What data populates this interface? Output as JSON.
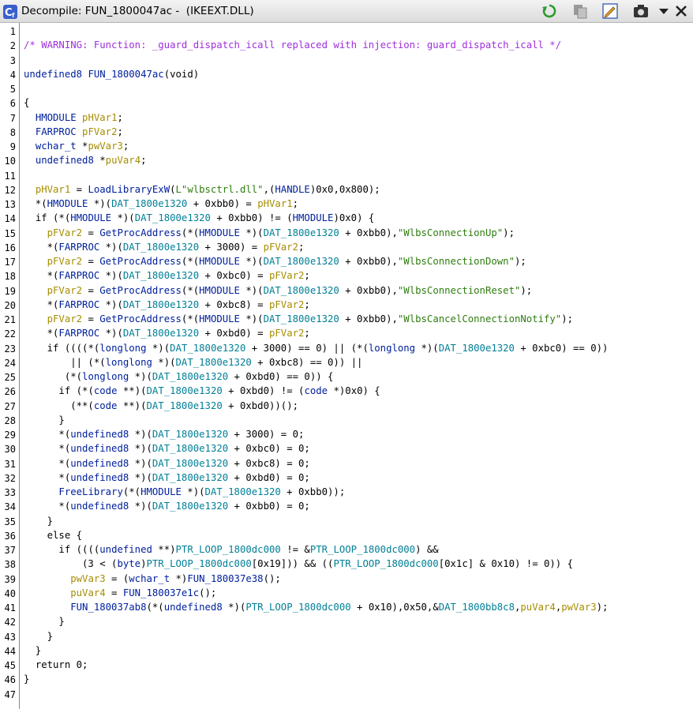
{
  "window": {
    "title": "Decompile: FUN_1800047ac -  (IKEEXT.DLL)",
    "icon": "decompiler-icon",
    "buttons": [
      {
        "name": "refresh-icon"
      },
      {
        "name": "copy-icon"
      },
      {
        "name": "edit-icon"
      },
      {
        "name": "snapshot-icon"
      },
      {
        "name": "chevron-down-icon"
      },
      {
        "name": "close-icon"
      }
    ]
  },
  "colors": {
    "comment": "#9e2fdd",
    "type": "#00209c",
    "variable": "#a58d00",
    "global": "#007f96",
    "string": "#2e7d0f"
  },
  "code": {
    "lines": [
      "",
      "/* WARNING: Function: _guard_dispatch_icall replaced with injection: guard_dispatch_icall */",
      "",
      "undefined8 FUN_1800047ac(void)",
      "",
      "{",
      "  HMODULE pHVar1;",
      "  FARPROC pFVar2;",
      "  wchar_t *pwVar3;",
      "  undefined8 *puVar4;",
      "",
      "  pHVar1 = LoadLibraryExW(L\"wlbsctrl.dll\",(HANDLE)0x0,0x800);",
      "  *(HMODULE *)(DAT_1800e1320 + 0xbb0) = pHVar1;",
      "  if (*(HMODULE *)(DAT_1800e1320 + 0xbb0) != (HMODULE)0x0) {",
      "    pFVar2 = GetProcAddress(*(HMODULE *)(DAT_1800e1320 + 0xbb0),\"WlbsConnectionUp\");",
      "    *(FARPROC *)(DAT_1800e1320 + 3000) = pFVar2;",
      "    pFVar2 = GetProcAddress(*(HMODULE *)(DAT_1800e1320 + 0xbb0),\"WlbsConnectionDown\");",
      "    *(FARPROC *)(DAT_1800e1320 + 0xbc0) = pFVar2;",
      "    pFVar2 = GetProcAddress(*(HMODULE *)(DAT_1800e1320 + 0xbb0),\"WlbsConnectionReset\");",
      "    *(FARPROC *)(DAT_1800e1320 + 0xbc8) = pFVar2;",
      "    pFVar2 = GetProcAddress(*(HMODULE *)(DAT_1800e1320 + 0xbb0),\"WlbsCancelConnectionNotify\");",
      "    *(FARPROC *)(DAT_1800e1320 + 0xbd0) = pFVar2;",
      "    if ((((*(longlong *)(DAT_1800e1320 + 3000) == 0) || (*(longlong *)(DAT_1800e1320 + 0xbc0) == 0))",
      "        || (*(longlong *)(DAT_1800e1320 + 0xbc8) == 0)) ||",
      "       (*(longlong *)(DAT_1800e1320 + 0xbd0) == 0)) {",
      "      if (*(code **)(DAT_1800e1320 + 0xbd0) != (code *)0x0) {",
      "        (**(code **)(DAT_1800e1320 + 0xbd0))();",
      "      }",
      "      *(undefined8 *)(DAT_1800e1320 + 3000) = 0;",
      "      *(undefined8 *)(DAT_1800e1320 + 0xbc0) = 0;",
      "      *(undefined8 *)(DAT_1800e1320 + 0xbc8) = 0;",
      "      *(undefined8 *)(DAT_1800e1320 + 0xbd0) = 0;",
      "      FreeLibrary(*(HMODULE *)(DAT_1800e1320 + 0xbb0));",
      "      *(undefined8 *)(DAT_1800e1320 + 0xbb0) = 0;",
      "    }",
      "    else {",
      "      if ((((undefined **)PTR_LOOP_1800dc000 != &PTR_LOOP_1800dc000) &&",
      "          (3 < (byte)PTR_LOOP_1800dc000[0x19])) && ((PTR_LOOP_1800dc000[0x1c] & 0x10) != 0)) {",
      "        pwVar3 = (wchar_t *)FUN_180037e38();",
      "        puVar4 = FUN_180037e1c();",
      "        FUN_180037ab8(*(undefined8 *)(PTR_LOOP_1800dc000 + 0x10),0x50,&DAT_1800bb8c8,puVar4,pwVar3);",
      "      }",
      "    }",
      "  }",
      "  return 0;",
      "}",
      ""
    ]
  }
}
